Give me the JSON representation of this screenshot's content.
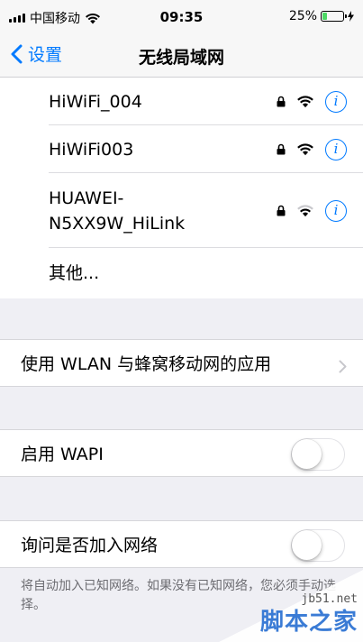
{
  "status": {
    "carrier": "中国移动",
    "time": "09:35",
    "battery": "25%",
    "battery_level": 0.25
  },
  "nav": {
    "back_label": "设置",
    "title": "无线局域网"
  },
  "networks": [
    {
      "name": "HiWiFi_004",
      "secured": true,
      "signal": "full"
    },
    {
      "name": "HiWiFi003",
      "secured": true,
      "signal": "full"
    },
    {
      "name": "HUAWEI-\nN5XX9W_HiLink",
      "secured": true,
      "signal": "medium"
    }
  ],
  "other_label": "其他...",
  "apps_row": {
    "label": "使用 WLAN 与蜂窝移动网的应用"
  },
  "wapi_row": {
    "label": "启用 WAPI",
    "on": false
  },
  "ask_row": {
    "label": "询问是否加入网络",
    "on": false
  },
  "footer_text": "将自动加入已知网络。如果没有已知网络，您必须手动选择。",
  "watermark": {
    "site": "jb51.net",
    "brand": "脚本之家"
  }
}
